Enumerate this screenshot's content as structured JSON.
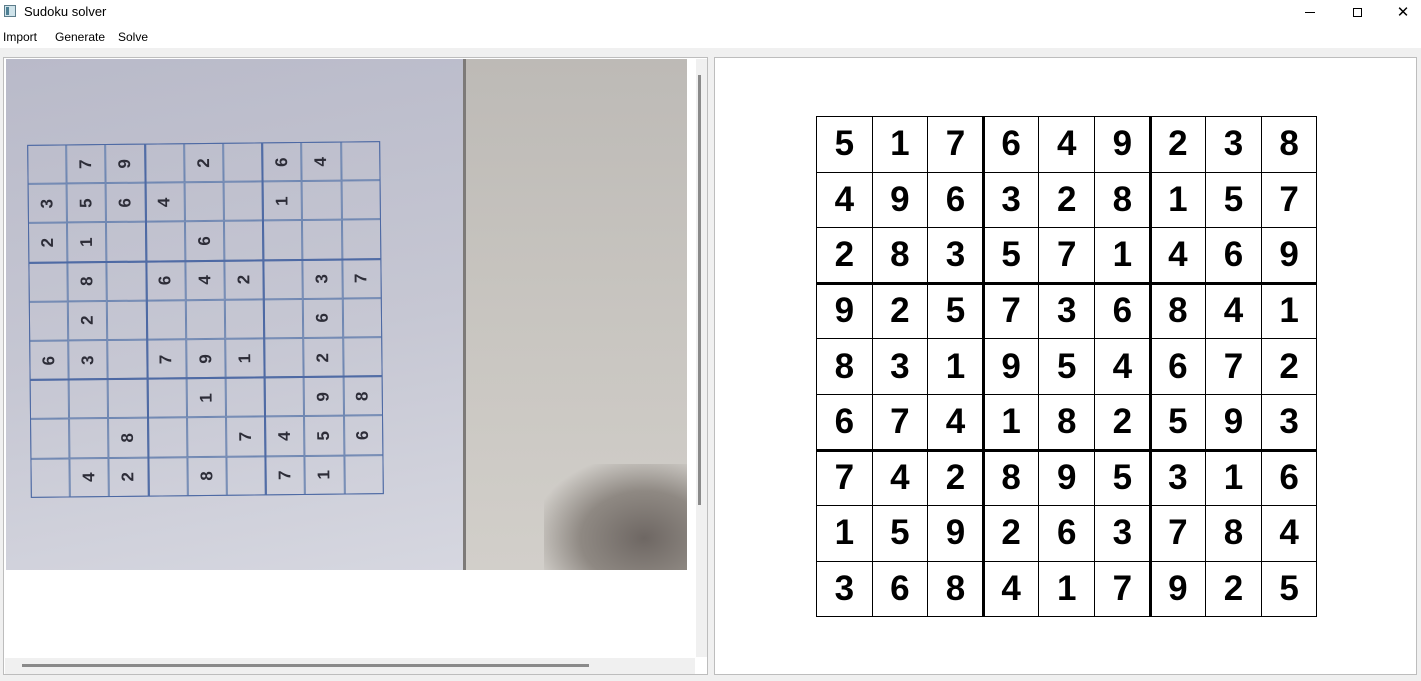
{
  "window": {
    "title": "Sudoku solver",
    "icon": "app-window-icon",
    "controls": [
      "minimize-icon",
      "maximize-icon",
      "close-icon"
    ],
    "close_glyph": "✕"
  },
  "menu": [
    "Import",
    "Generate",
    "Solve"
  ],
  "photo": {
    "description_icon": "camera-photo",
    "grid": [
      [
        "",
        "7",
        "9",
        "",
        "2",
        "",
        "6",
        "4",
        ""
      ],
      [
        "3",
        "5",
        "6",
        "4",
        "",
        "",
        "1",
        "",
        ""
      ],
      [
        "2",
        "1",
        "",
        "",
        "6",
        "",
        "",
        "",
        ""
      ],
      [
        "",
        "8",
        "",
        "6",
        "4",
        "2",
        "",
        "3",
        "7"
      ],
      [
        "",
        "2",
        "",
        "",
        "",
        "",
        "",
        "6",
        ""
      ],
      [
        "6",
        "3",
        "",
        "7",
        "9",
        "1",
        "",
        "2",
        ""
      ],
      [
        "",
        "",
        "",
        "",
        "1",
        "",
        "",
        "9",
        "8"
      ],
      [
        "",
        "",
        "8",
        "",
        "",
        "7",
        "4",
        "5",
        "6"
      ],
      [
        "",
        "4",
        "2",
        "",
        "8",
        "",
        "7",
        "1",
        ""
      ]
    ]
  },
  "solution": {
    "rows": [
      [
        "5",
        "1",
        "7",
        "6",
        "4",
        "9",
        "2",
        "3",
        "8"
      ],
      [
        "4",
        "9",
        "6",
        "3",
        "2",
        "8",
        "1",
        "5",
        "7"
      ],
      [
        "2",
        "8",
        "3",
        "5",
        "7",
        "1",
        "4",
        "6",
        "9"
      ],
      [
        "9",
        "2",
        "5",
        "7",
        "3",
        "6",
        "8",
        "4",
        "1"
      ],
      [
        "8",
        "3",
        "1",
        "9",
        "5",
        "4",
        "6",
        "7",
        "2"
      ],
      [
        "6",
        "7",
        "4",
        "1",
        "8",
        "2",
        "5",
        "9",
        "3"
      ],
      [
        "7",
        "4",
        "2",
        "8",
        "9",
        "5",
        "3",
        "1",
        "6"
      ],
      [
        "1",
        "5",
        "9",
        "2",
        "6",
        "3",
        "7",
        "8",
        "4"
      ],
      [
        "3",
        "6",
        "8",
        "4",
        "1",
        "7",
        "9",
        "2",
        "5"
      ]
    ]
  }
}
